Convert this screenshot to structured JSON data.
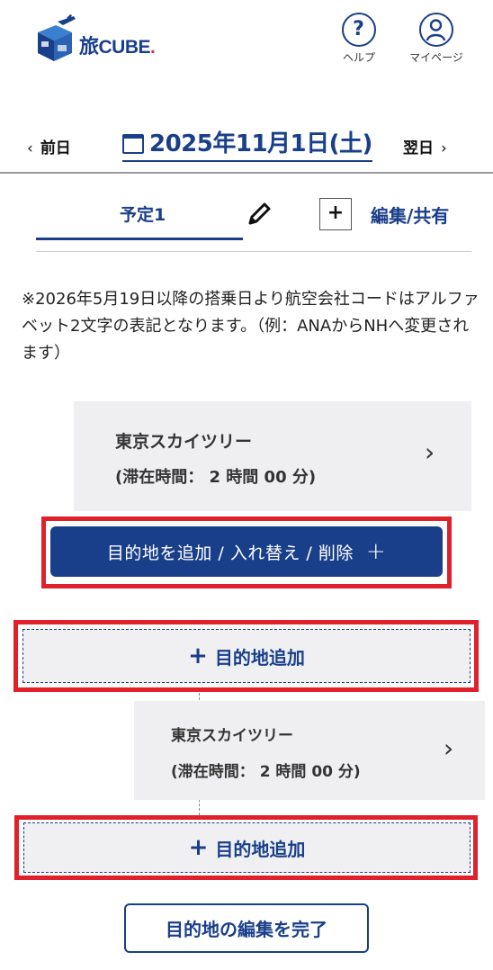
{
  "header": {
    "logo_kanji": "旅",
    "logo_latin": "CUBE",
    "logo_dot": ".",
    "help_label": "ヘルプ",
    "mypage_label": "マイページ"
  },
  "date_nav": {
    "prev_label": "前日",
    "next_label": "翌日",
    "current_date": "2025年11月1日(土)"
  },
  "tabs": {
    "active_label": "予定1",
    "add_symbol": "+",
    "edit_share_label": "編集/共有"
  },
  "notice": "※2026年5月19日以降の搭乗日より航空会社コードはアルファベット2文字の表記となります。（例：ANAからNHへ変更されます）",
  "destinations": [
    {
      "name": "東京スカイツリー",
      "stay": "(滞在時間： 2 時間 00 分)"
    },
    {
      "name": "東京スカイツリー",
      "stay": "(滞在時間： 2 時間 00 分)"
    }
  ],
  "buttons": {
    "add_replace_delete": "目的地を追加 / 入れ替え / 削除",
    "add_destination": "目的地追加",
    "finish_edit": "目的地の編集を完了"
  },
  "colors": {
    "brand_blue": "#1a3f8a",
    "highlight_red": "#e0202a",
    "card_gray": "#efeff1"
  }
}
